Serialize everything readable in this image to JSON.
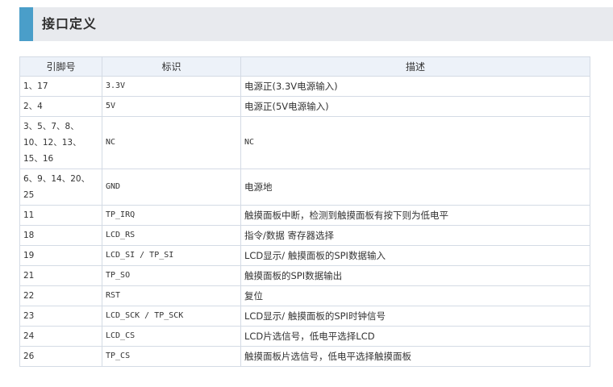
{
  "header": {
    "title": "接口定义"
  },
  "table": {
    "columns": [
      "引脚号",
      "标识",
      "描述"
    ],
    "rows": [
      {
        "pin": "1、17",
        "id": "3.3V",
        "desc": "电源正(3.3V电源输入)"
      },
      {
        "pin": "2、4",
        "id": "5V",
        "desc": "电源正(5V电源输入)"
      },
      {
        "pin": "3、5、7、8、\n10、12、13、\n15、16",
        "id": "NC",
        "desc": "NC"
      },
      {
        "pin": "6、9、14、20、\n25",
        "id": "GND",
        "desc": "电源地"
      },
      {
        "pin": "11",
        "id": "TP_IRQ",
        "desc": "触摸面板中断，检测到触摸面板有按下则为低电平"
      },
      {
        "pin": "18",
        "id": "LCD_RS",
        "desc": "指令/数据 寄存器选择"
      },
      {
        "pin": "19",
        "id": "LCD_SI / TP_SI",
        "desc": "LCD显示/ 触摸面板的SPI数据输入"
      },
      {
        "pin": "21",
        "id": "TP_SO",
        "desc": "触摸面板的SPI数据输出"
      },
      {
        "pin": "22",
        "id": "RST",
        "desc": "复位"
      },
      {
        "pin": "23",
        "id": "LCD_SCK / TP_SCK",
        "desc": "LCD显示/ 触摸面板的SPI时钟信号"
      },
      {
        "pin": "24",
        "id": "LCD_CS",
        "desc": "LCD片选信号，低电平选择LCD"
      },
      {
        "pin": "26",
        "id": "TP_CS",
        "desc": "触摸面板片选信号，低电平选择触摸面板"
      }
    ]
  }
}
